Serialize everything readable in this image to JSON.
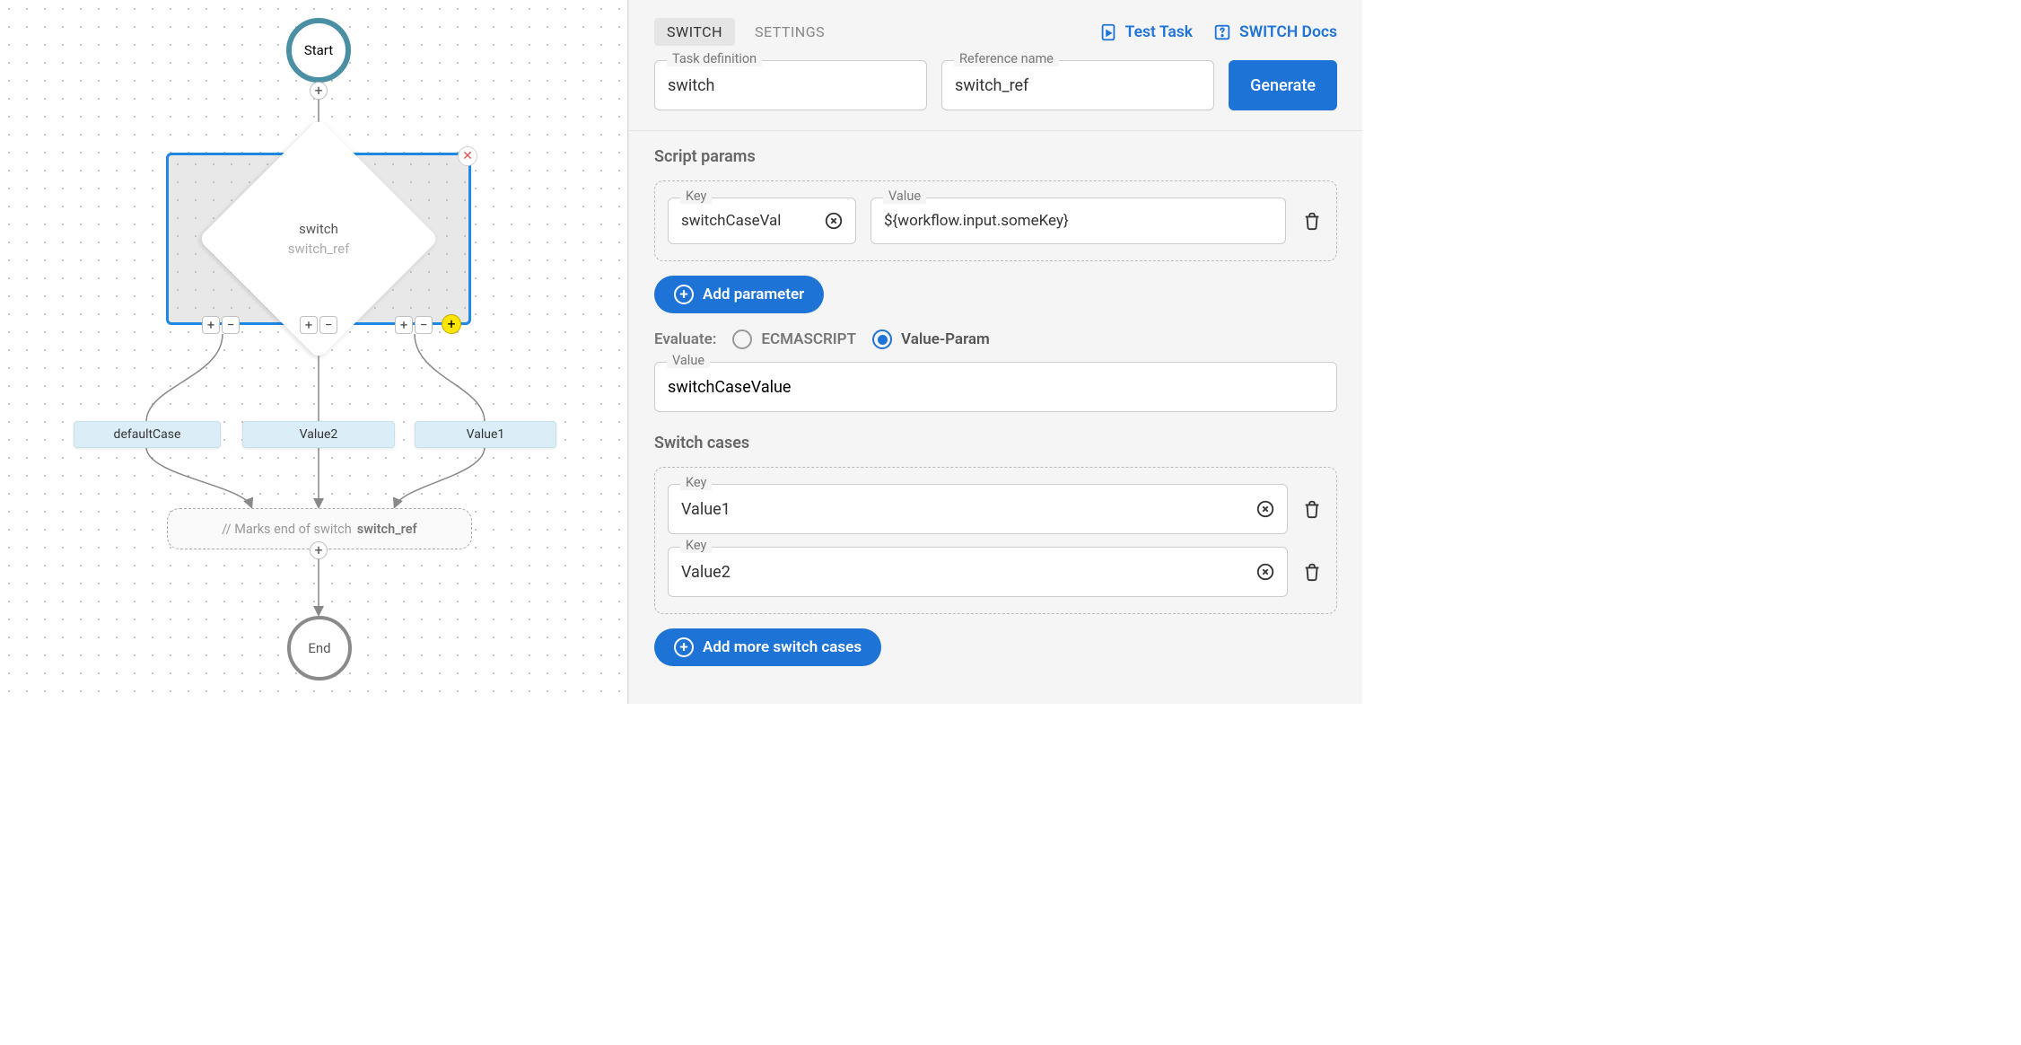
{
  "diagram": {
    "start_label": "Start",
    "end_label": "End",
    "switch_title": "switch",
    "switch_ref": "switch_ref",
    "cases": [
      "defaultCase",
      "Value2",
      "Value1"
    ],
    "end_marker_prefix": "// Marks end of switch",
    "end_marker_ref": "switch_ref"
  },
  "panel": {
    "tabs": {
      "switch": "SWITCH",
      "settings": "SETTINGS"
    },
    "links": {
      "test_task": "Test Task",
      "docs": "SWITCH Docs"
    },
    "task_def_label": "Task definition",
    "task_def_value": "switch",
    "ref_name_label": "Reference name",
    "ref_name_value": "switch_ref",
    "generate": "Generate",
    "script_params_heading": "Script params",
    "param_key_label": "Key",
    "param_key_value": "switchCaseVal",
    "param_val_label": "Value",
    "param_val_value": "${workflow.input.someKey}",
    "add_param": "Add parameter",
    "evaluate_label": "Evaluate:",
    "eval_opt_ecma": "ECMASCRIPT",
    "eval_opt_value": "Value-Param",
    "value_label": "Value",
    "value_value": "switchCaseValue",
    "switch_cases_heading": "Switch cases",
    "case_key_label": "Key",
    "case1": "Value1",
    "case2": "Value2",
    "add_cases": "Add more switch cases"
  }
}
